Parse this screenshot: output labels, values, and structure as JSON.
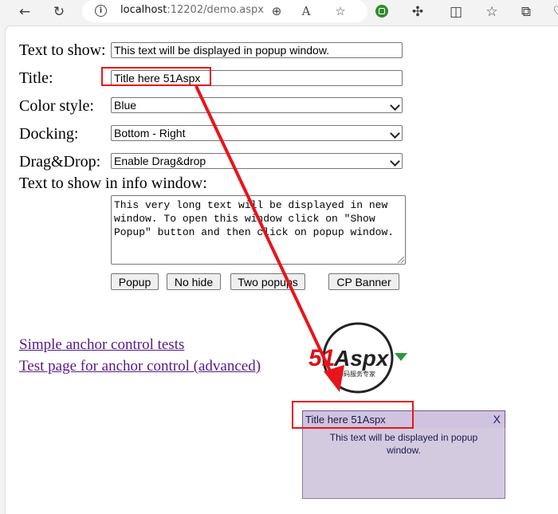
{
  "browser": {
    "url_host": "localhost",
    "url_rest": ":12202/demo.aspx"
  },
  "form": {
    "text_to_show_label": "Text to show:",
    "text_to_show_value": "This text will be displayed in popup window.",
    "title_label": "Title:",
    "title_value": "Title here 51Aspx",
    "color_style_label": "Color style:",
    "color_style_value": "Blue",
    "docking_label": "Docking:",
    "docking_value": "Bottom - Right",
    "dragdrop_label": "Drag&Drop:",
    "dragdrop_value": "Enable Drag&drop",
    "info_label": "Text to show in info window:",
    "info_value": "This very long text will be displayed in new window. To open this window click on \"Show Popup\" button and then click on popup window."
  },
  "buttons": {
    "popup": "Popup",
    "no_hide": "No hide",
    "two_popups": "Two popups",
    "cp_banner": "CP Banner"
  },
  "links": {
    "simple": "Simple anchor control tests",
    "advanced": "Test page for anchor control (advanced)"
  },
  "logo": {
    "prefix": "51",
    "name": "Aspx",
    "tagline": "源码服务专家"
  },
  "popup": {
    "title": "Title here 51Aspx",
    "close": "X",
    "body": "This text will be displayed in popup window."
  },
  "colors": {
    "annotation": "#e8141c",
    "popup_bg": "#d4cae0",
    "link": "#551a8b"
  }
}
